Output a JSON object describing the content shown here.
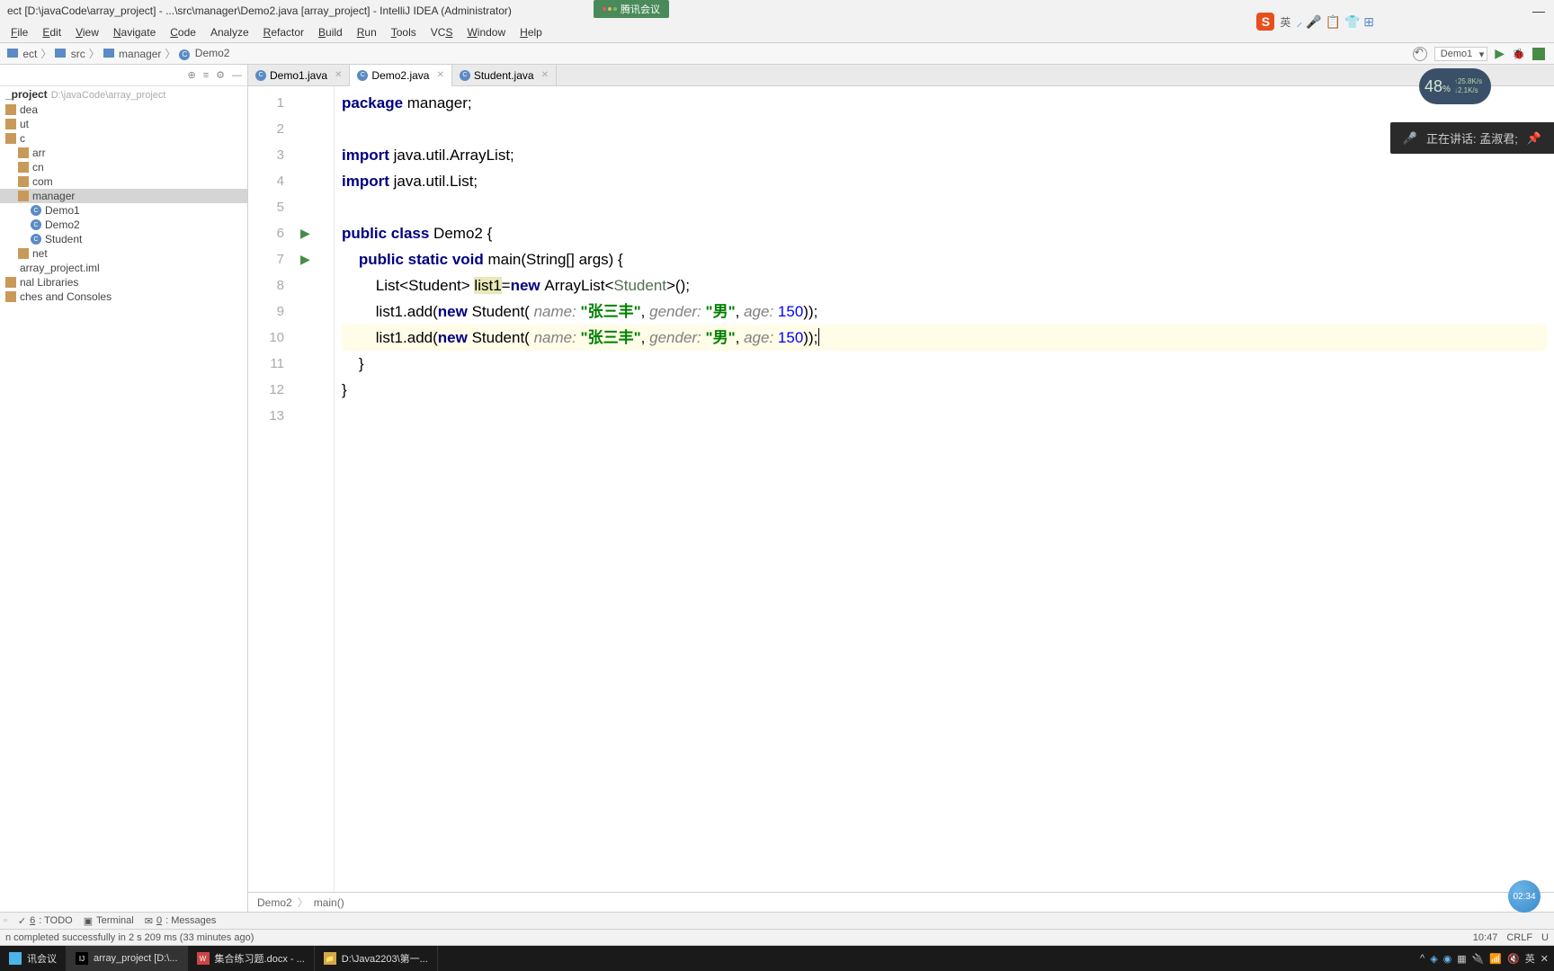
{
  "title": "ect [D:\\javaCode\\array_project] - ...\\src\\manager\\Demo2.java [array_project] - IntelliJ IDEA (Administrator)",
  "meeting_badge": "腾讯会议",
  "sogou": {
    "lang": "英",
    "icons": "⸝ 🎤 📋 👕 ⊞"
  },
  "menu": [
    "File",
    "Edit",
    "View",
    "Navigate",
    "Code",
    "Analyze",
    "Refactor",
    "Build",
    "Run",
    "Tools",
    "VCS",
    "Window",
    "Help"
  ],
  "menu_underline": [
    "F",
    "E",
    "V",
    "N",
    "C",
    "",
    "R",
    "B",
    "R",
    "T",
    "S",
    "W",
    "H"
  ],
  "nav": {
    "crumbs": [
      "ect",
      "src",
      "manager",
      "Demo2"
    ]
  },
  "run_config": "Demo1",
  "sidebar": {
    "root_name": "_project",
    "root_path": "D:\\javaCode\\array_project",
    "items": [
      {
        "label": "dea",
        "indent": 0,
        "icon": "folder"
      },
      {
        "label": "ut",
        "indent": 0,
        "icon": "folder"
      },
      {
        "label": "c",
        "indent": 0,
        "icon": "folder"
      },
      {
        "label": "arr",
        "indent": 1,
        "icon": "folder"
      },
      {
        "label": "cn",
        "indent": 1,
        "icon": "folder"
      },
      {
        "label": "com",
        "indent": 1,
        "icon": "folder"
      },
      {
        "label": "manager",
        "indent": 1,
        "icon": "folder",
        "selected": true
      },
      {
        "label": "Demo1",
        "indent": 2,
        "icon": "jclass"
      },
      {
        "label": "Demo2",
        "indent": 2,
        "icon": "jclass"
      },
      {
        "label": "Student",
        "indent": 2,
        "icon": "jclass"
      },
      {
        "label": "net",
        "indent": 1,
        "icon": "folder"
      },
      {
        "label": "array_project.iml",
        "indent": 0,
        "icon": "file"
      },
      {
        "label": "nal Libraries",
        "indent": 0,
        "icon": "lib"
      },
      {
        "label": "ches and Consoles",
        "indent": 0,
        "icon": "folder"
      }
    ]
  },
  "tabs": [
    {
      "label": "Demo1.java",
      "active": false
    },
    {
      "label": "Demo2.java",
      "active": true
    },
    {
      "label": "Student.java",
      "active": false
    }
  ],
  "editor": {
    "lines": {
      "1": [
        {
          "t": "package ",
          "c": "kw"
        },
        {
          "t": "manager;"
        }
      ],
      "2": [],
      "3": [
        {
          "t": "import ",
          "c": "kw"
        },
        {
          "t": "java.util.ArrayList;"
        }
      ],
      "4": [
        {
          "t": "import ",
          "c": "kw"
        },
        {
          "t": "java.util.List;"
        }
      ],
      "5": [],
      "6": [
        {
          "t": "public class ",
          "c": "kw"
        },
        {
          "t": "Demo2 {"
        }
      ],
      "7": [
        {
          "t": "    "
        },
        {
          "t": "public static void ",
          "c": "kw"
        },
        {
          "t": "main(String[] args) {"
        }
      ],
      "8": [
        {
          "t": "        List<Student> "
        },
        {
          "t": "list1",
          "c": "hl"
        },
        {
          "t": "="
        },
        {
          "t": "new ",
          "c": "kw"
        },
        {
          "t": "ArrayList<"
        },
        {
          "t": "Student",
          "c": "type-param"
        },
        {
          "t": ">();"
        }
      ],
      "9": [
        {
          "t": "        list1.add("
        },
        {
          "t": "new ",
          "c": "kw"
        },
        {
          "t": "Student( "
        },
        {
          "t": "name: ",
          "c": "param"
        },
        {
          "t": "\"张三丰\"",
          "c": "str"
        },
        {
          "t": ", "
        },
        {
          "t": "gender: ",
          "c": "param"
        },
        {
          "t": "\"男\"",
          "c": "str"
        },
        {
          "t": ", "
        },
        {
          "t": "age: ",
          "c": "param"
        },
        {
          "t": "150",
          "c": "num"
        },
        {
          "t": "));"
        }
      ],
      "10": [
        {
          "t": "        list1.add("
        },
        {
          "t": "new ",
          "c": "kw"
        },
        {
          "t": "Student( "
        },
        {
          "t": "name: ",
          "c": "param"
        },
        {
          "t": "\"张三丰\"",
          "c": "str"
        },
        {
          "t": ", "
        },
        {
          "t": "gender: ",
          "c": "param"
        },
        {
          "t": "\"男\"",
          "c": "str"
        },
        {
          "t": ", "
        },
        {
          "t": "age: ",
          "c": "param"
        },
        {
          "t": "150",
          "c": "num"
        },
        {
          "t": "));"
        }
      ],
      "11": [
        {
          "t": "    }"
        }
      ],
      "12": [
        {
          "t": "}"
        }
      ],
      "13": []
    },
    "run_marks": [
      6,
      7
    ],
    "caret_line": 10
  },
  "breadcrumb_bottom": [
    "Demo2",
    "main()"
  ],
  "tool_windows": [
    {
      "num": "6",
      "label": "TODO",
      "icon": "✓"
    },
    {
      "num": "",
      "label": "Terminal",
      "icon": "▣"
    },
    {
      "num": "0",
      "label": "Messages",
      "icon": "✉"
    }
  ],
  "status": {
    "left": "n completed successfully in 2 s 209 ms (33 minutes ago)",
    "right": [
      "10:47",
      "CRLF",
      "U"
    ]
  },
  "taskbar_items": [
    {
      "label": "讯会议",
      "color": "#4ab4e8"
    },
    {
      "label": "array_project [D:\\...",
      "color": "#000",
      "icon": "IJ"
    },
    {
      "label": "集合练习题.docx - ...",
      "color": "#c44",
      "icon": "W"
    },
    {
      "label": "D:\\Java2203\\第一...",
      "color": "#d4a848",
      "icon": "📁"
    }
  ],
  "cpu": {
    "pct": "48",
    "unit": "%",
    "up": "25.8",
    "dn": "2.1",
    "unit2": "K/s"
  },
  "speaking": "正在讲话: 孟淑君;",
  "time_bubble": "02:34"
}
